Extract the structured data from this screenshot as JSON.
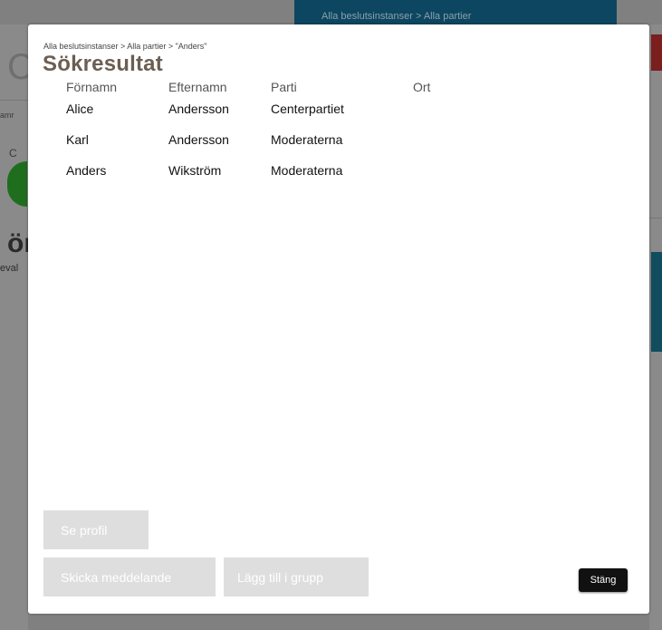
{
  "background": {
    "topbar_breadcrumb": "Alla beslutsinstanser > Alla partier",
    "left_fragments": [
      "C",
      "amr",
      "C",
      "ör",
      "eval"
    ]
  },
  "modal": {
    "breadcrumb": "Alla beslutsinstanser > Alla partier > \"Anders\"",
    "title": "Sökresultat",
    "columns": [
      "Förnamn",
      "Efternamn",
      "Parti",
      "Ort"
    ],
    "rows": [
      {
        "firstname": "Alice",
        "lastname": "Andersson",
        "party": "Centerpartiet",
        "city": ""
      },
      {
        "firstname": "Karl",
        "lastname": "Andersson",
        "party": "Moderaterna",
        "city": ""
      },
      {
        "firstname": "Anders",
        "lastname": "Wikström",
        "party": "Moderaterna",
        "city": ""
      }
    ],
    "buttons": {
      "profile": "Se profil",
      "message": "Skicka meddelande",
      "add_group": "Lägg till i grupp",
      "close": "Stäng"
    }
  },
  "colors": {
    "title": "#6b5e52",
    "disabled_button": "#dedede",
    "close_button": "#111111",
    "topbar": "#0d4660"
  }
}
